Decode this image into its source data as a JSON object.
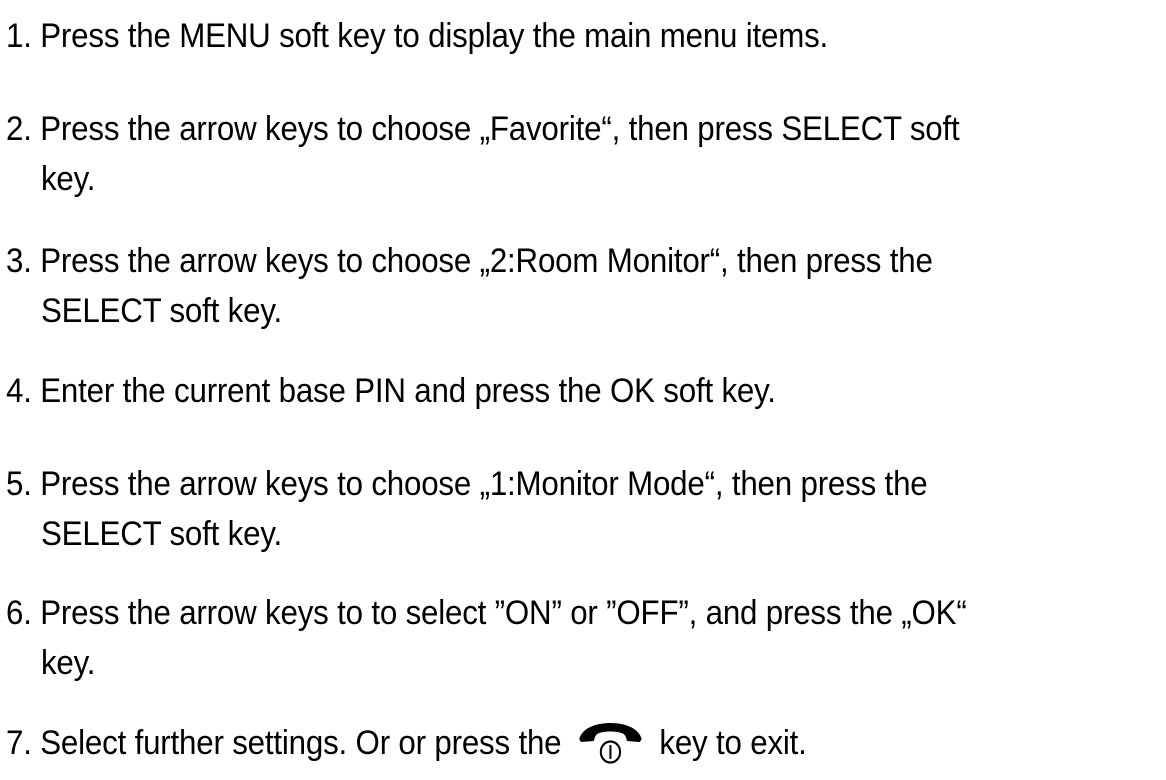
{
  "steps": [
    {
      "number": "1.",
      "line1": "Press the MENU soft key to display the main menu items.",
      "line2": ""
    },
    {
      "number": "2.",
      "line1": "Press the arrow keys to choose „Favorite“, then press SELECT soft",
      "line2": "key."
    },
    {
      "number": "3.",
      "line1": "Press the arrow keys to choose „2:Room Monitor“, then press the",
      "line2": "SELECT soft key."
    },
    {
      "number": "4.",
      "line1": "Enter the current base PIN and press the OK soft key.",
      "line2": ""
    },
    {
      "number": "5.",
      "line1": "Press the arrow keys to choose „1:Monitor Mode“, then press the",
      "line2": "SELECT soft key."
    },
    {
      "number": "6.",
      "line1": "Press the arrow keys to to select ”ON” or ”OFF”, and press the „OK“",
      "line2": "key."
    }
  ],
  "step7": {
    "number": "7.",
    "before_icon": "Select further settings. Or or press the",
    "icon": "end-call-key-icon",
    "after_icon": "key to exit."
  }
}
